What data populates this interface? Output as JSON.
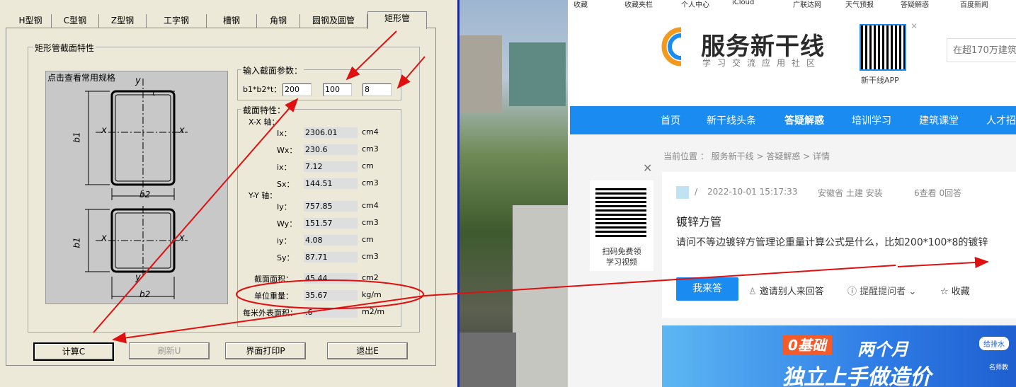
{
  "dialog": {
    "tabs": [
      "H型钢",
      "C型钢",
      "Z型钢",
      "工字钢",
      "槽钢",
      "角钢",
      "圆钢及圆管",
      "矩形管"
    ],
    "active_tab": "矩形管",
    "group_title": "矩形管截面特性",
    "diagram_caption": "点击查看常用规格",
    "diagram_labels": {
      "y": "y",
      "x": "x",
      "t": "t",
      "b1": "b1",
      "b2": "b2"
    },
    "input_group_title": "输入截面参数：",
    "input_label": "b1*b2*t：",
    "inputs": [
      "200",
      "100",
      "8"
    ],
    "props_title": "截面特性：",
    "xx_axis_label": "X-X 轴：",
    "yy_axis_label": "Y-Y 轴：",
    "xx_props": [
      {
        "name": "Ix：",
        "value": "2306.01",
        "unit": "cm4"
      },
      {
        "name": "Wx：",
        "value": "230.6",
        "unit": "cm3"
      },
      {
        "name": "ix：",
        "value": "7.12",
        "unit": "cm"
      },
      {
        "name": "Sx：",
        "value": "144.51",
        "unit": "cm3"
      }
    ],
    "yy_props": [
      {
        "name": "Iy：",
        "value": "757.85",
        "unit": "cm4"
      },
      {
        "name": "Wy：",
        "value": "151.57",
        "unit": "cm3"
      },
      {
        "name": "iy：",
        "value": "4.08",
        "unit": "cm"
      },
      {
        "name": "Sy：",
        "value": "87.71",
        "unit": "cm3"
      }
    ],
    "area": {
      "name": "截面面积：",
      "value": "45.44",
      "unit": "cm2"
    },
    "weight": {
      "name": "单位重量：",
      "value": "35.67",
      "unit": "kg/m"
    },
    "surface": {
      "name": "每米外表面积：",
      "value": ".6",
      "unit": "m2/m"
    },
    "buttons": [
      "计算C",
      "刷新U",
      "界面打印P",
      "退出E"
    ]
  },
  "browser": {
    "bookmarks": [
      "收藏",
      "收藏夹栏",
      "个人中心",
      "iCloud",
      "广联达网",
      "天气预报",
      "答疑解惑",
      "百度新闻"
    ],
    "logo_title": "服务新干线",
    "logo_sub": "学习交流应用社区",
    "app_label": "新干线APP",
    "search_placeholder": "在超170万建筑",
    "nav": [
      "首页",
      "新干线头条",
      "答疑解惑",
      "培训学习",
      "建筑课堂",
      "人才招"
    ],
    "breadcrumb": "当前位置 ： 服务新干线 > 答疑解惑 > 详情",
    "qr_caption_1": "扫码免费领",
    "qr_caption_2": "学习视频",
    "post_meta": {
      "slash": "/",
      "time": "2022-10-01 15:17:33",
      "location": "安徽省 土建 安装",
      "stats": "6查看 0回答"
    },
    "post_title": "镀锌方管",
    "post_body": "请问不等边镀锌方管理论重量计算公式是什么，比如200*100*8的镀锌",
    "answer_button": "我来答",
    "invite": "邀请别人来回答",
    "remind": "提醒提问者",
    "collect": "收藏",
    "banner": {
      "tag": "0基础",
      "line1": "两个月",
      "line2": "独立上手做造价",
      "badge": "给排水",
      "small": "名师教"
    },
    "colors": {
      "brand_blue": "#1a8bf0",
      "nav_blue": "#1a8bf0",
      "accent_orange": "#f39a1e"
    }
  }
}
